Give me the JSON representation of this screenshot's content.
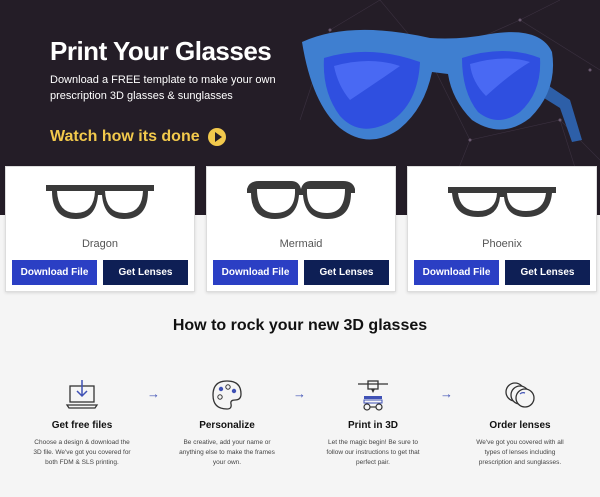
{
  "hero": {
    "title": "Print Your Glasses",
    "subtitle_line1": "Download a FREE template to make your own",
    "subtitle_line2": "prescription 3D glasses & sunglasses",
    "watch_label": "Watch how its done",
    "lens_color": "#2f4fe0",
    "frame_color": "#3f7fd0",
    "accent_color": "#f2c94c"
  },
  "cards": [
    {
      "name": "Dragon",
      "download_label": "Download File",
      "lenses_label": "Get Lenses"
    },
    {
      "name": "Mermaid",
      "download_label": "Download File",
      "lenses_label": "Get Lenses"
    },
    {
      "name": "Phoenix",
      "download_label": "Download File",
      "lenses_label": "Get Lenses"
    }
  ],
  "section": {
    "title": "How to rock your new 3D glasses"
  },
  "steps": [
    {
      "icon": "laptop-download-icon",
      "title": "Get free files",
      "desc_line1": "Choose a design & download the",
      "desc_line2": "3D file. We've got you covered for",
      "desc_line3": "both FDM & SLS printing."
    },
    {
      "icon": "palette-icon",
      "title": "Personalize",
      "desc_line1": "Be creative, add your name or",
      "desc_line2": "anything else to make the frames",
      "desc_line3": "your own."
    },
    {
      "icon": "3d-printer-icon",
      "title": "Print in 3D",
      "desc_line1": "Let the magic begin! Be sure to",
      "desc_line2": "follow our instructions to get that",
      "desc_line3": "perfect pair."
    },
    {
      "icon": "lenses-icon",
      "title": "Order lenses",
      "desc_line1": "We've got you covered with all",
      "desc_line2": "types of lenses including",
      "desc_line3": "prescription and sunglasses."
    }
  ],
  "arrow_glyph": "→"
}
